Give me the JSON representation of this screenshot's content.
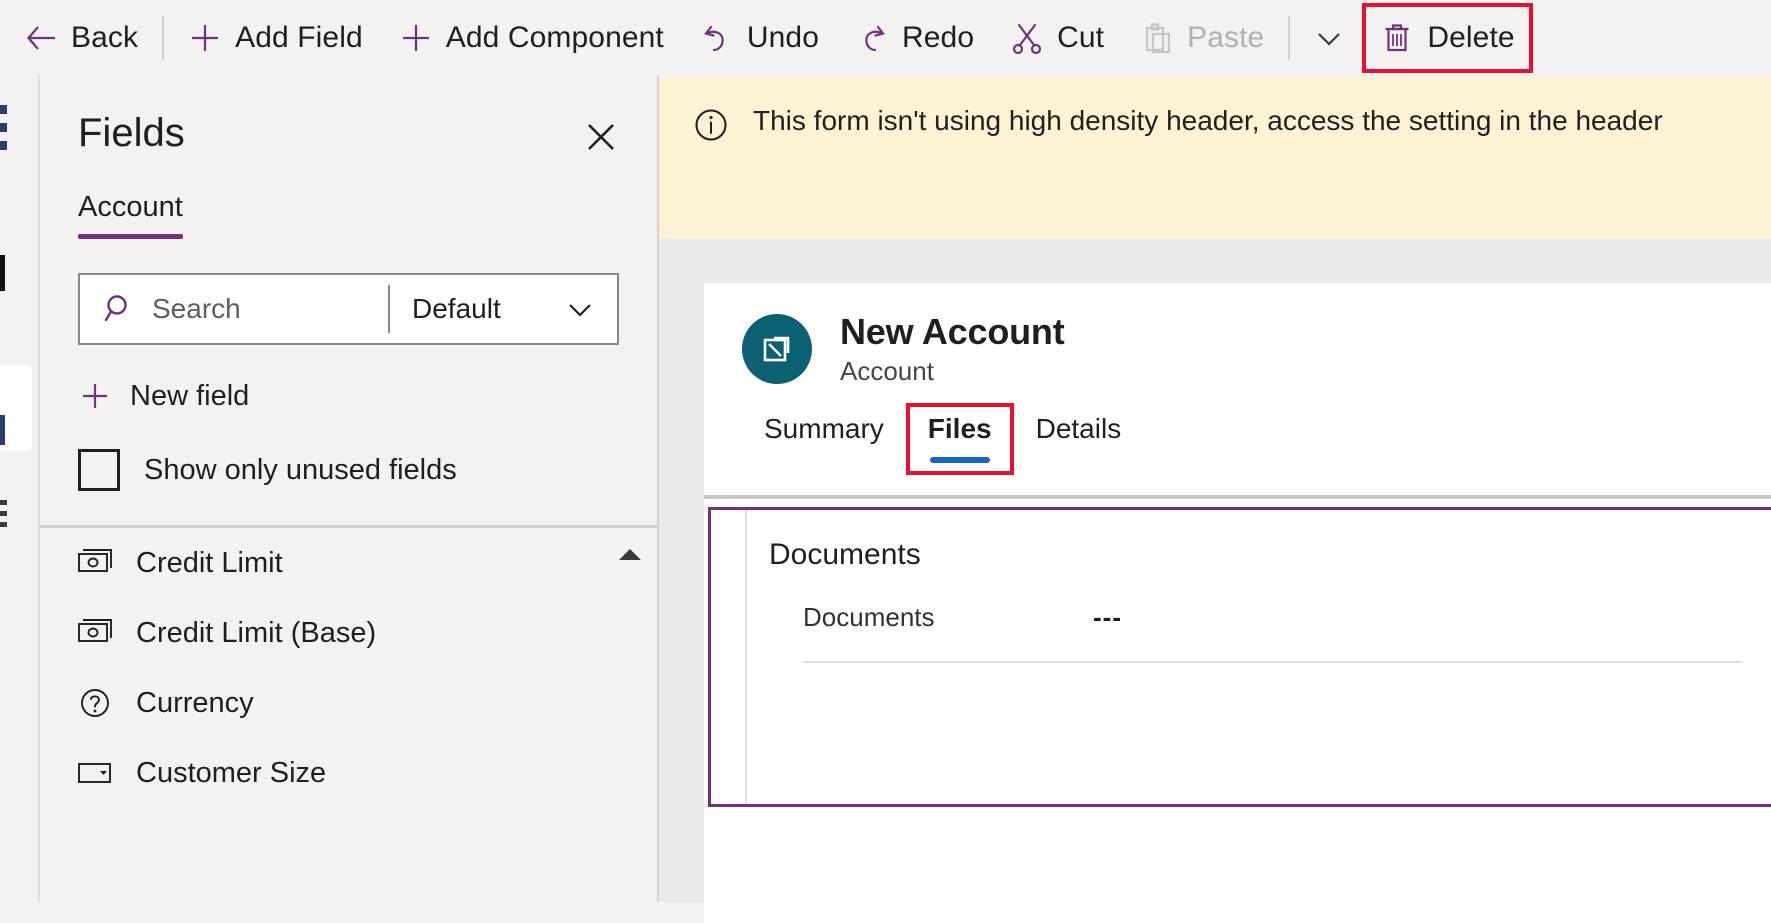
{
  "toolbar": {
    "items": [
      {
        "id": "back",
        "label": "Back",
        "icon": "arrow-left-icon",
        "disabled": false,
        "highlighted": false
      },
      {
        "id": "add-field",
        "label": "Add Field",
        "icon": "plus-icon",
        "disabled": false,
        "highlighted": false
      },
      {
        "id": "add-component",
        "label": "Add Component",
        "icon": "plus-icon",
        "disabled": false,
        "highlighted": false
      },
      {
        "id": "undo",
        "label": "Undo",
        "icon": "undo-icon",
        "disabled": false,
        "highlighted": false
      },
      {
        "id": "redo",
        "label": "Redo",
        "icon": "redo-icon",
        "disabled": false,
        "highlighted": false
      },
      {
        "id": "cut",
        "label": "Cut",
        "icon": "scissors-icon",
        "disabled": false,
        "highlighted": false
      },
      {
        "id": "paste",
        "label": "Paste",
        "icon": "clipboard-icon",
        "disabled": true,
        "highlighted": false
      },
      {
        "id": "delete",
        "label": "Delete",
        "icon": "trash-icon",
        "disabled": false,
        "highlighted": true
      }
    ],
    "accent_color": "#71317f",
    "highlight_color": "#e8112d",
    "disabled_color": "#b3b0ad"
  },
  "fields_panel": {
    "title": "Fields",
    "close_label": "Close",
    "tab_label": "Account",
    "tab_indicator_color": "#71317f",
    "search": {
      "placeholder": "Search",
      "filter_value": "Default"
    },
    "new_field_label": "New field",
    "show_unused_label": "Show only unused fields",
    "show_unused_checked": false,
    "items": [
      {
        "label": "Credit Limit",
        "icon": "currency-icon"
      },
      {
        "label": "Credit Limit (Base)",
        "icon": "currency-icon"
      },
      {
        "label": "Currency",
        "icon": "lookup-question-icon"
      },
      {
        "label": "Customer Size",
        "icon": "choice-dropdown-icon"
      }
    ]
  },
  "notification": {
    "icon": "info-icon",
    "message": "This form isn't using high density header, access the setting in the header",
    "background_color": "#fdf3d4"
  },
  "form_preview": {
    "avatar_icon": "account-entity-icon",
    "avatar_color": "#0b6171",
    "record_title": "New Account",
    "entity_name": "Account",
    "tabs": [
      {
        "label": "Summary",
        "active": false,
        "highlighted": false
      },
      {
        "label": "Files",
        "active": true,
        "highlighted": true
      },
      {
        "label": "Details",
        "active": false,
        "highlighted": false
      }
    ],
    "active_tab_underline_color": "#0f6cbd",
    "selection_border_color": "#71317f",
    "section": {
      "title": "Documents",
      "rows": [
        {
          "name": "Documents",
          "value": "---"
        }
      ]
    }
  },
  "left_rail": {
    "accent_color": "#2c3e6b"
  }
}
